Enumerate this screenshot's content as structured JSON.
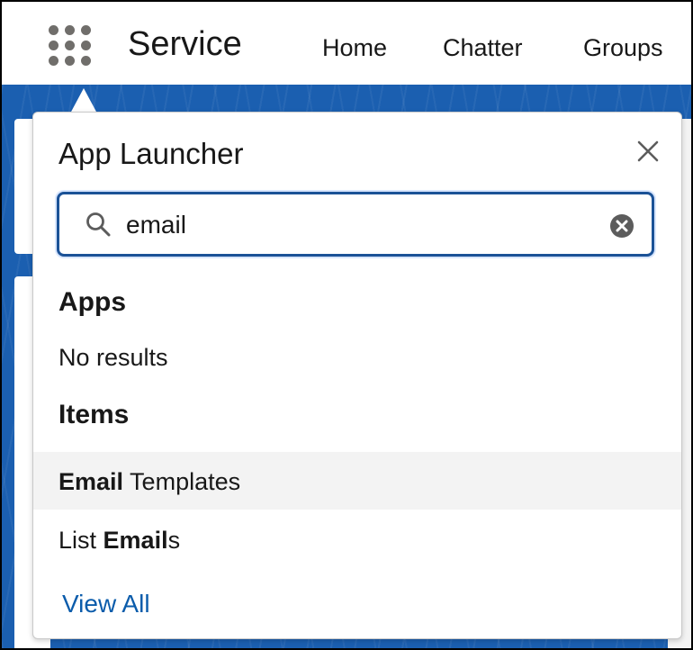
{
  "header": {
    "app_name": "Service",
    "nav": [
      "Home",
      "Chatter",
      "Groups"
    ]
  },
  "launcher": {
    "title": "App Launcher",
    "search": {
      "value": "email"
    },
    "apps_heading": "Apps",
    "apps_empty": "No results",
    "items_heading": "Items",
    "items": [
      {
        "bold": "Email",
        "rest": " Templates",
        "highlighted": true
      },
      {
        "pre": "List ",
        "bold": "Email",
        "rest": "s",
        "highlighted": false
      }
    ],
    "view_all": "View All"
  },
  "colors": {
    "accent": "#0b5cab",
    "backdrop": "#1b5fb0",
    "focus_border": "#1b5297"
  },
  "icons": [
    "app-launcher-waffle-icon",
    "close-icon",
    "search-icon",
    "clear-icon"
  ]
}
